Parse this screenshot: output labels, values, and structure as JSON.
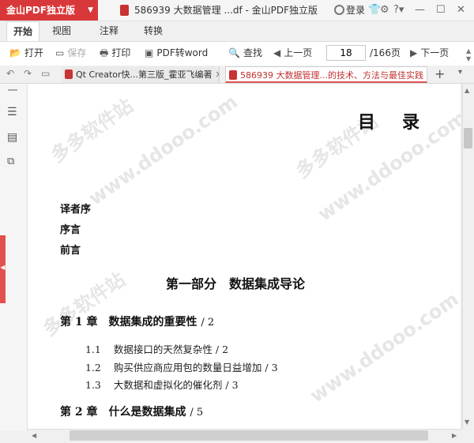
{
  "app": {
    "brand": "金山PDF独立版",
    "window_title": "586939 大数据管理 ...df - 金山PDF独立版",
    "login_label": "登录"
  },
  "ribbon": {
    "tabs": [
      {
        "label": "开始",
        "active": true
      },
      {
        "label": "视图",
        "active": false
      },
      {
        "label": "注释",
        "active": false
      },
      {
        "label": "转换",
        "active": false
      }
    ]
  },
  "toolbar": {
    "open": "打开",
    "save": "保存",
    "print": "打印",
    "to_word": "PDF转word",
    "find": "查找",
    "prev_page": "上一页",
    "current_page": "18",
    "total_pages": "/166页",
    "next_page": "下一页"
  },
  "doc_tabs": [
    {
      "label": "Qt Creator快...第三版_霍亚飞编著",
      "active": false
    },
    {
      "label": "586939 大数据管理...的技术、方法与最佳实践",
      "active": true
    }
  ],
  "document": {
    "heading": "目　录",
    "front_matter": [
      "译者序",
      "序言",
      "前言"
    ],
    "part_title": "第一部分　数据集成导论",
    "chapters": [
      {
        "label": "第 1 章",
        "title": "数据集成的重要性",
        "page": "/ 2",
        "sections": [
          {
            "num": "1.1",
            "title": "数据接口的天然复杂性",
            "page": "/ 2"
          },
          {
            "num": "1.2",
            "title": "购买供应商应用包的数量日益增加",
            "page": "/ 3"
          },
          {
            "num": "1.3",
            "title": "大数据和虚拟化的催化剂",
            "page": "/ 3"
          }
        ]
      },
      {
        "label": "第 2 章",
        "title": "什么是数据集成",
        "page": "/ 5",
        "sections": []
      }
    ],
    "watermarks": [
      "多多软件站",
      "www.ddooo.com",
      "多多软件站",
      "www.ddooo.com",
      "多多软件站",
      "www.ddooo.com"
    ]
  },
  "colors": {
    "brand_red": "#d9383a",
    "active_tab_text": "#c03030"
  }
}
